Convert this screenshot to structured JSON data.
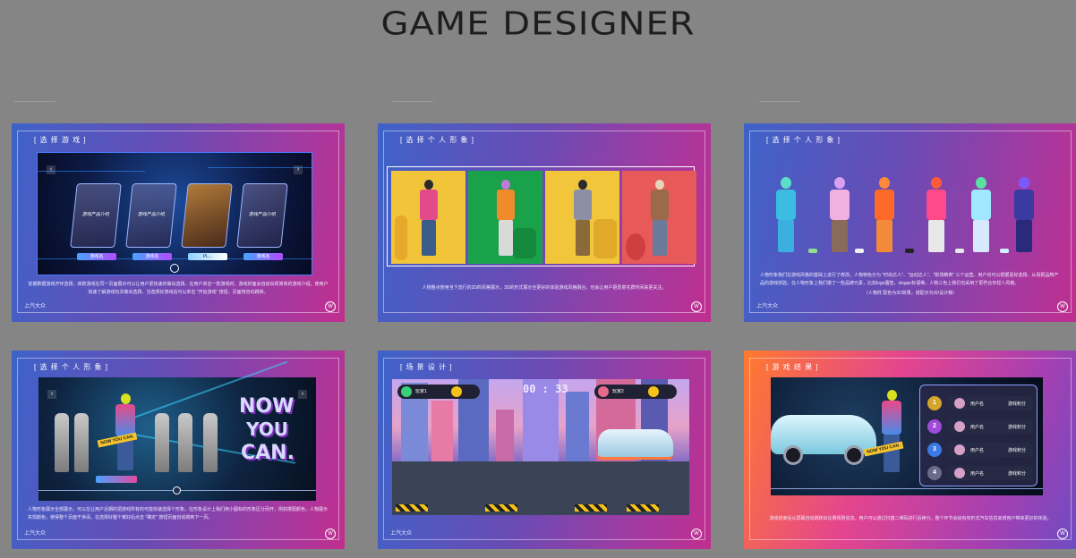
{
  "page": {
    "title": "GAME DESIGNER"
  },
  "cards": [
    {
      "title": "[ 选 择 游 戏 ]",
      "brand": "上汽大众",
      "game_labels": [
        "游戏产品介绍",
        "游戏产品介绍",
        "",
        "游戏产品介绍"
      ],
      "game_buttons": [
        "游戏名",
        "游戏名",
        "PL...",
        "游戏名"
      ],
      "desc": "前期数据游戏开环选择。四款游戏在同一页面展示可以让用户更快速的做出选择。在用户单击一款游戏时，游戏封面会自动出现简单的游戏介绍。使用户快速了解游戏玩法做出选择。当选择好游戏后可以单击 \"开始游戏\" 按钮，页面将自动跳转。"
    },
    {
      "title": "[ 选 择 个 人 形 象 ]",
      "brand": "",
      "desc": "人物整点使用当下流行的3D的风格展示，3D的形式展示全更好的体验游戏风格融合。也会让用户更愿意花费时间来更关注。"
    },
    {
      "title": "[ 选 择 个 人 形 象 ]",
      "brand": "上汽大众",
      "desc": "人物形象我们在游戏风格的基础上进行了修改，人物特色分为 \"时尚达人\"、\"运动达人\"、\"职场精英\" 三个运营。用户也可以根据喜好选择。从而把品牌产品的游戏体验。在人物形象上我们做了一些品牌元素，比如logo露签，slogan标语等。人物三色上我们也采用了更符合年轻人风格。",
      "note": "（人物样 配色为3D效果，搭配示为3D设计稿）"
    },
    {
      "title": "[ 选 择 个 人 形 象 ]",
      "brand": "上汽大众",
      "big_text": [
        "NOW",
        "YOU",
        "CAN."
      ],
      "tag": "NOW YOU CAN.",
      "desc": "人物形象展示全部展示，可以在让用户近期的把游戏所有的可能快速选择个形象。在形象设计上我们用小图标的形象区分而开，例如搭配颜色，人物展示实现颜色，使得整个页面干净清。在选择好整个某好后点击 \"确定\" 按钮页面自动跳到下一页。"
    },
    {
      "title": "[ 场 景 设 计 ]",
      "brand": "上汽大众",
      "timer": "00 : 33",
      "player_left": "玩家1",
      "player_right": "玩家2"
    },
    {
      "title": "[ 游 戏 结 果 ]",
      "brand": "",
      "ranks": [
        {
          "rank": "1",
          "name": "用户名",
          "score": "游戏积分"
        },
        {
          "rank": "2",
          "name": "用户名",
          "score": "游戏积分"
        },
        {
          "rank": "3",
          "name": "用户名",
          "score": "游戏积分"
        },
        {
          "rank": "4",
          "name": "用户名",
          "score": "游戏积分"
        }
      ],
      "tag": "NOW YOU CAN.",
      "desc": "游戏结束后从屏幕自动跳转出比赛规则信息。用户可以通过扫描二维码进行后续分。整个环节会给有有形式汽车信息来增用户带来更好的体验。"
    }
  ],
  "colors": {
    "background": "#858585",
    "accent_blue": "#3e63c9",
    "accent_magenta": "#c02e8e",
    "accent_orange": "#ff7a2e"
  },
  "icons": [
    "vw-logo-icon",
    "chevron-left-icon",
    "chevron-right-icon"
  ]
}
